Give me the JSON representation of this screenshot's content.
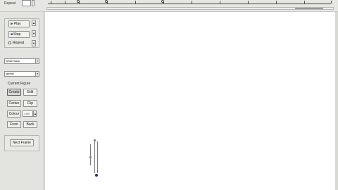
{
  "header": {
    "repeat_label": "Repeat",
    "repeat_value": ""
  },
  "playback": {
    "play_label": "Play",
    "stop_label": "Stop",
    "repeat_label": "Repeat",
    "play_icon": "play-icon",
    "stop_icon": "stop-icon"
  },
  "controls": {
    "background_value": "White Back",
    "figure_value": "labelsf",
    "current_figure_label": "Current Figure",
    "create_label": "Create",
    "edit_label": "Edit",
    "center_label": "Center",
    "flip_label": "Flip",
    "colour_label": "Colour",
    "scale_value": "1.00",
    "front_label": "Front",
    "back_label": "Back",
    "next_frame_label": "Next Frame"
  },
  "colors": {
    "panel": "#e3e3df",
    "canvas": "#ffffff",
    "head_joint": "#1d2aa8"
  }
}
